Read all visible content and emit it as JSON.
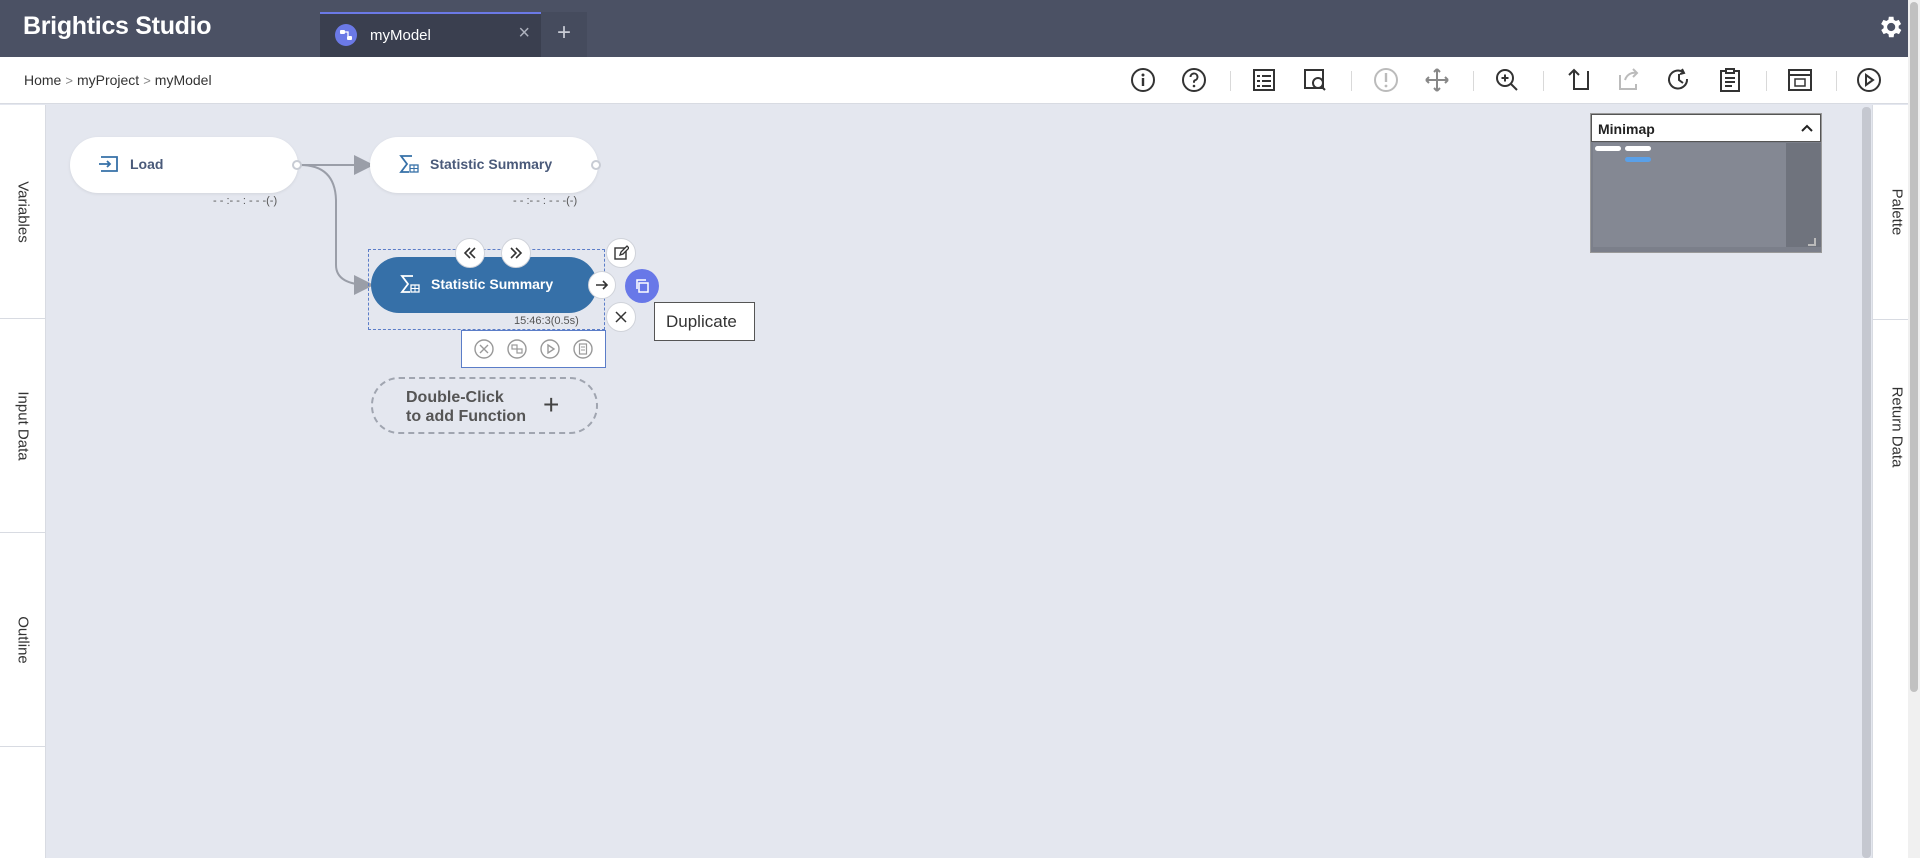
{
  "header": {
    "brand": "Brightics Studio",
    "tab_label": "myModel",
    "tab_close": "×",
    "tab_add": "+"
  },
  "breadcrumb": {
    "items": [
      "Home",
      "myProject",
      "myModel"
    ],
    "separator": ">"
  },
  "left_panel": {
    "tabs": [
      "Variables",
      "Input Data",
      "Outline"
    ]
  },
  "right_panel": {
    "tabs": [
      "Palette",
      "Return Data"
    ]
  },
  "nodes": {
    "load": {
      "label": "Load",
      "status": "- - :- - : - - -(-)"
    },
    "summary1": {
      "label": "Statistic Summary",
      "status": "- - :- - : - - -(-)"
    },
    "summary2": {
      "label": "Statistic Summary",
      "status": "15:46:3(0.5s)"
    }
  },
  "tooltip": {
    "text": "Duplicate"
  },
  "add_function": {
    "line1": "Double-Click",
    "line2": "to add Function",
    "plus": "+"
  },
  "minimap": {
    "title": "Minimap"
  },
  "colors": {
    "header_bg": "#4b5164",
    "accent": "#6878e8",
    "selected_node": "#3670a8",
    "canvas_bg": "#e4e7ef"
  },
  "icons": {
    "toolbar": [
      "info-icon",
      "help-icon",
      "checklist-icon",
      "report-icon",
      "warning-icon",
      "move-icon",
      "zoom-icon",
      "undo-icon",
      "redo-icon",
      "history-icon",
      "clipboard-icon",
      "layout-icon",
      "run-icon"
    ]
  }
}
